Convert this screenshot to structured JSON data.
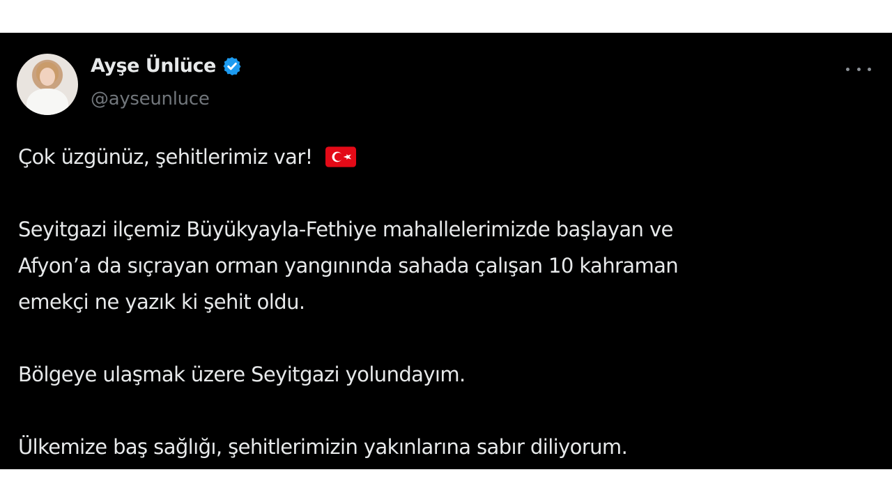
{
  "tweet": {
    "author_name": "Ayşe Ünlüce",
    "author_handle": "@ayseunluce",
    "verified": true,
    "accent_color": "#1d9bf0",
    "avatar_icon": "profile-photo",
    "more_icon": "more-options-icon",
    "paragraphs": [
      "Çok üzgünüz, şehitlerimiz var!",
      "Seyitgazi ilçemiz Büyükyayla-Fethiye mahallelerimizde başlayan ve",
      "Afyon’a da sıçrayan orman yangınında sahada çalışan 10 kahraman",
      "emekçi ne yazık ki şehit oldu.",
      "Bölgeye ulaşmak üzere Seyitgazi yolundayım.",
      "Ülkemize baş sağlığı, şehitlerimizin yakınlarına sabır diliyorum."
    ],
    "emoji": "turkey-flag"
  }
}
